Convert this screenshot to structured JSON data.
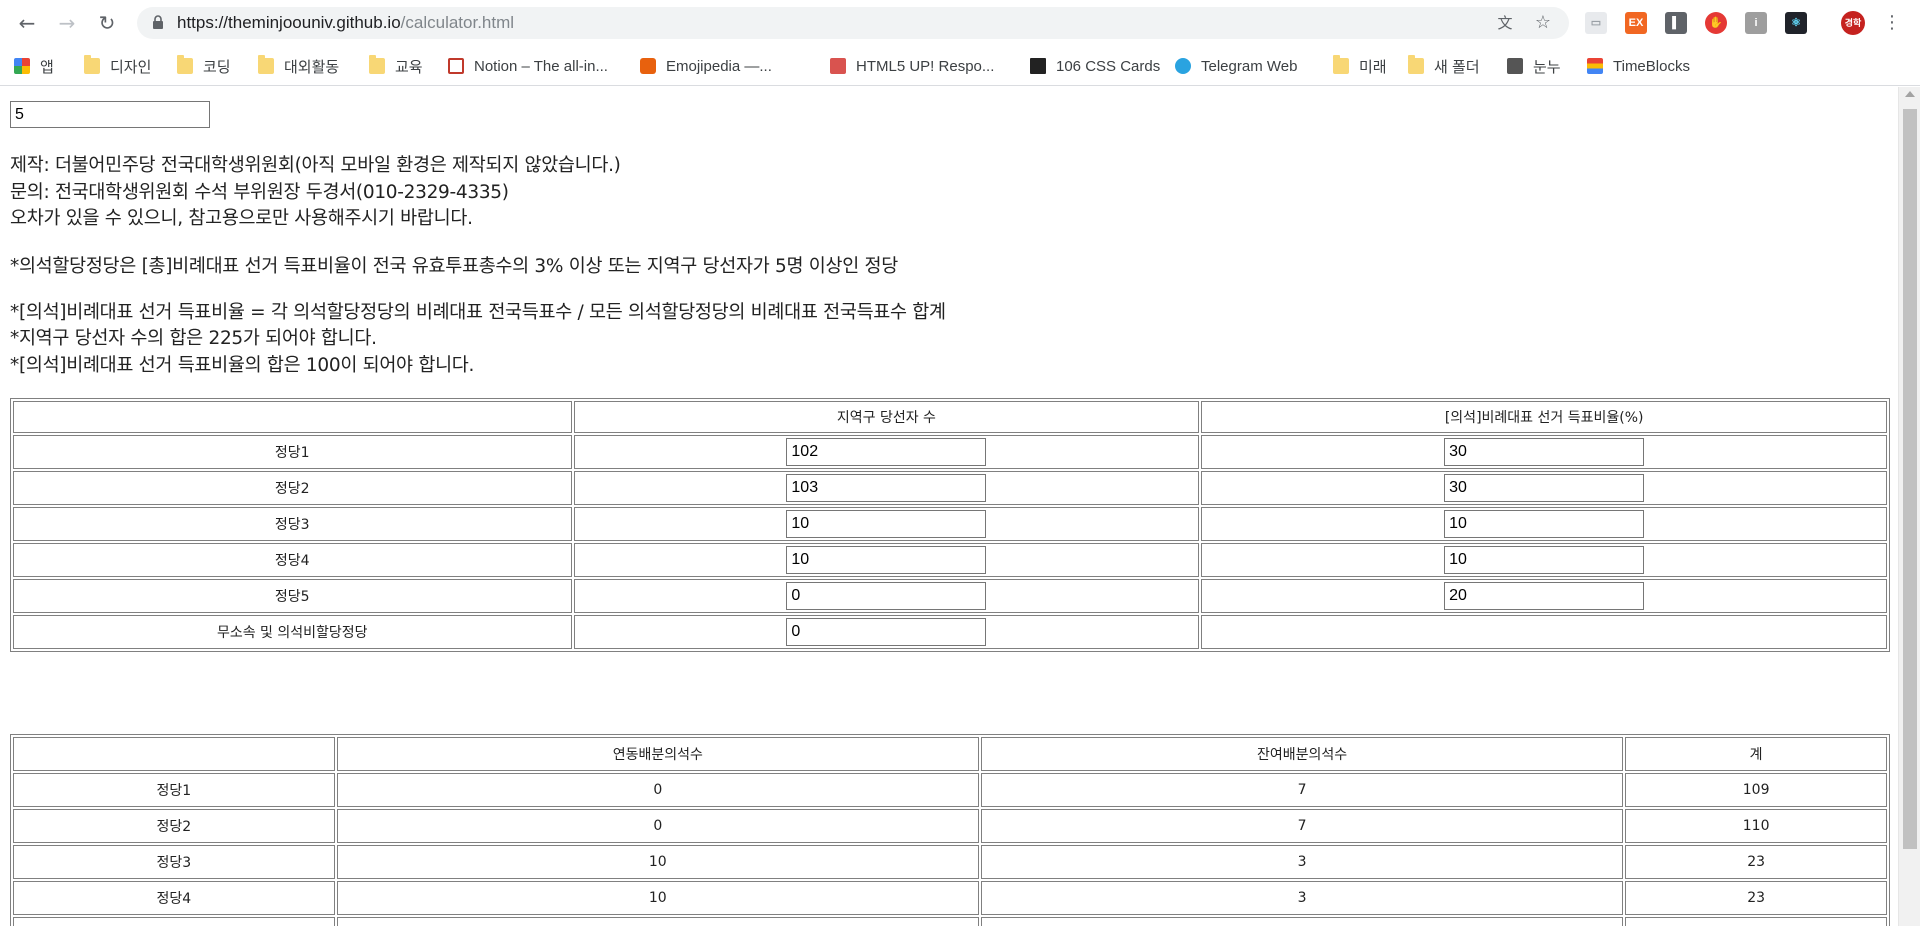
{
  "browser": {
    "url_host": "https://theminjoouniv.github.io",
    "url_path": "/calculator.html",
    "profile_label": "경학",
    "bookmarks": [
      {
        "label": "앱",
        "icon": "apps-grid-icon"
      },
      {
        "label": "디자인",
        "icon": "folder-icon"
      },
      {
        "label": "코딩",
        "icon": "folder-icon"
      },
      {
        "label": "대외활동",
        "icon": "folder-icon"
      },
      {
        "label": "교육",
        "icon": "folder-icon"
      },
      {
        "label": "Notion – The all-in...",
        "icon": "notion-icon"
      },
      {
        "label": "Emojipedia —...",
        "icon": "emojipedia-icon"
      },
      {
        "label": "HTML5 UP! Respo...",
        "icon": "html5up-icon"
      },
      {
        "label": "106 CSS Cards",
        "icon": "css-cards-icon"
      },
      {
        "label": "Telegram Web",
        "icon": "telegram-icon"
      },
      {
        "label": "미래",
        "icon": "folder-icon"
      },
      {
        "label": "새 폴더",
        "icon": "folder-icon"
      },
      {
        "label": "눈누",
        "icon": "noonnu-icon"
      },
      {
        "label": "TimeBlocks",
        "icon": "timeblocks-icon"
      }
    ]
  },
  "page": {
    "seats_value": "5",
    "intro_lines": [
      "제작: 더불어민주당 전국대학생위원회(아직 모바일 환경은 제작되지 않았습니다.)",
      "문의: 전국대학생위원회 수석 부위원장 두경서(010-2329-4335)",
      "오차가 있을 수 있으니, 참고용으로만 사용해주시기 바랍니다."
    ],
    "note_eligibility": "*의석할당정당은 [총]비례대표 선거 득표비율이 전국 유효투표총수의 3% 이상 또는 지역구 당선자가 5명 이상인 정당",
    "rule_lines": [
      "*[의석]비례대표 선거 득표비율 = 각 의석할당정당의 비례대표 전국득표수 / 모든 의석할당정당의 비례대표 전국득표수 합계",
      "*지역구 당선자 수의 합은 225가 되어야 합니다.",
      "*[의석]비례대표 선거 득표비율의 합은 100이 되어야 합니다."
    ],
    "input_table": {
      "headers": [
        "",
        "지역구 당선자 수",
        "[의석]비례대표 선거 득표비율(%)"
      ],
      "rows": [
        {
          "name": "정당1",
          "district": "102",
          "ratio": "30"
        },
        {
          "name": "정당2",
          "district": "103",
          "ratio": "30"
        },
        {
          "name": "정당3",
          "district": "10",
          "ratio": "10"
        },
        {
          "name": "정당4",
          "district": "10",
          "ratio": "10"
        },
        {
          "name": "정당5",
          "district": "0",
          "ratio": "20"
        }
      ],
      "independent": {
        "name": "무소속 및 의석비할당정당",
        "district": "0"
      }
    },
    "result_table": {
      "headers": [
        "",
        "연동배분의석수",
        "잔여배분의석수",
        "계"
      ],
      "rows": [
        {
          "name": "정당1",
          "linked": "0",
          "remaining": "7",
          "total": "109"
        },
        {
          "name": "정당2",
          "linked": "0",
          "remaining": "7",
          "total": "110"
        },
        {
          "name": "정당3",
          "linked": "10",
          "remaining": "3",
          "total": "23"
        },
        {
          "name": "정당4",
          "linked": "10",
          "remaining": "3",
          "total": "23"
        }
      ]
    }
  }
}
